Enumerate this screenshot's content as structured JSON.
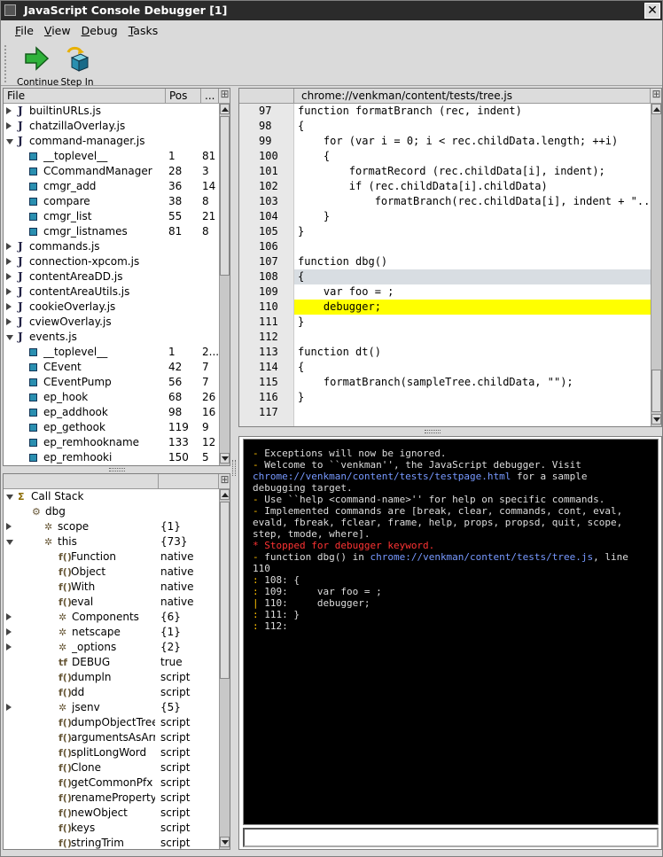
{
  "window": {
    "title": "JavaScript Console Debugger  [1]",
    "close_label": "✕"
  },
  "menu": [
    "File",
    "View",
    "Debug",
    "Tasks"
  ],
  "toolbar": {
    "continue_label": "Continue",
    "stepin_label": "Step In"
  },
  "scripts": {
    "headers": [
      "File",
      "Pos",
      "..."
    ],
    "rows": [
      {
        "kind": "file",
        "open": false,
        "name": "builtinURLs.js",
        "pos": "",
        "len": ""
      },
      {
        "kind": "file",
        "open": false,
        "name": "chatzillaOverlay.js",
        "pos": "",
        "len": ""
      },
      {
        "kind": "file",
        "open": true,
        "name": "command-manager.js",
        "pos": "",
        "len": ""
      },
      {
        "kind": "fn",
        "name": "__toplevel__",
        "pos": "1",
        "len": "81"
      },
      {
        "kind": "fn",
        "name": "CCommandManager",
        "pos": "28",
        "len": "3"
      },
      {
        "kind": "fn",
        "name": "cmgr_add",
        "pos": "36",
        "len": "14"
      },
      {
        "kind": "fn",
        "name": "compare",
        "pos": "38",
        "len": "8"
      },
      {
        "kind": "fn",
        "name": "cmgr_list",
        "pos": "55",
        "len": "21"
      },
      {
        "kind": "fn",
        "name": "cmgr_listnames",
        "pos": "81",
        "len": "8"
      },
      {
        "kind": "file",
        "open": false,
        "name": "commands.js",
        "pos": "",
        "len": ""
      },
      {
        "kind": "file",
        "open": false,
        "name": "connection-xpcom.js",
        "pos": "",
        "len": ""
      },
      {
        "kind": "file",
        "open": false,
        "name": "contentAreaDD.js",
        "pos": "",
        "len": ""
      },
      {
        "kind": "file",
        "open": false,
        "name": "contentAreaUtils.js",
        "pos": "",
        "len": ""
      },
      {
        "kind": "file",
        "open": false,
        "name": "cookieOverlay.js",
        "pos": "",
        "len": ""
      },
      {
        "kind": "file",
        "open": false,
        "name": "cviewOverlay.js",
        "pos": "",
        "len": ""
      },
      {
        "kind": "file",
        "open": true,
        "name": "events.js",
        "pos": "",
        "len": ""
      },
      {
        "kind": "fn",
        "name": "__toplevel__",
        "pos": "1",
        "len": "2..."
      },
      {
        "kind": "fn",
        "name": "CEvent",
        "pos": "42",
        "len": "7"
      },
      {
        "kind": "fn",
        "name": "CEventPump",
        "pos": "56",
        "len": "7"
      },
      {
        "kind": "fn",
        "name": "ep_hook",
        "pos": "68",
        "len": "26"
      },
      {
        "kind": "fn",
        "name": "ep_addhook",
        "pos": "98",
        "len": "16"
      },
      {
        "kind": "fn",
        "name": "ep_gethook",
        "pos": "119",
        "len": "9"
      },
      {
        "kind": "fn",
        "name": "ep_remhookname",
        "pos": "133",
        "len": "12"
      },
      {
        "kind": "fn",
        "name": "ep_remhooki",
        "pos": "150",
        "len": "5"
      }
    ]
  },
  "stack": {
    "rows": [
      {
        "indent": 0,
        "twisty": "open",
        "icon": "sigma",
        "name": "Call Stack",
        "value": ""
      },
      {
        "indent": 1,
        "twisty": "none",
        "icon": "frame",
        "name": "dbg",
        "value": ""
      },
      {
        "indent": 2,
        "twisty": "closed",
        "icon": "obj",
        "name": "scope",
        "value": "{1}"
      },
      {
        "indent": 2,
        "twisty": "open",
        "icon": "obj",
        "name": "this",
        "value": "{73}"
      },
      {
        "indent": 3,
        "twisty": "none",
        "icon": "fn",
        "name": "Function",
        "value": "native"
      },
      {
        "indent": 3,
        "twisty": "none",
        "icon": "fn",
        "name": "Object",
        "value": "native"
      },
      {
        "indent": 3,
        "twisty": "none",
        "icon": "fn",
        "name": "With",
        "value": "native"
      },
      {
        "indent": 3,
        "twisty": "none",
        "icon": "fn",
        "name": "eval",
        "value": "native"
      },
      {
        "indent": 3,
        "twisty": "closed",
        "icon": "obj",
        "name": "Components",
        "value": "{6}"
      },
      {
        "indent": 3,
        "twisty": "closed",
        "icon": "obj",
        "name": "netscape",
        "value": "{1}"
      },
      {
        "indent": 3,
        "twisty": "closed",
        "icon": "obj",
        "name": "_options",
        "value": "{2}"
      },
      {
        "indent": 3,
        "twisty": "none",
        "icon": "bool",
        "name": "DEBUG",
        "value": "true"
      },
      {
        "indent": 3,
        "twisty": "none",
        "icon": "fn",
        "name": "dumpln",
        "value": "script"
      },
      {
        "indent": 3,
        "twisty": "none",
        "icon": "fn",
        "name": "dd",
        "value": "script"
      },
      {
        "indent": 3,
        "twisty": "closed",
        "icon": "obj",
        "name": "jsenv",
        "value": "{5}"
      },
      {
        "indent": 3,
        "twisty": "none",
        "icon": "fn",
        "name": "dumpObjectTree",
        "value": "script"
      },
      {
        "indent": 3,
        "twisty": "none",
        "icon": "fn",
        "name": "argumentsAsArr...",
        "value": "script"
      },
      {
        "indent": 3,
        "twisty": "none",
        "icon": "fn",
        "name": "splitLongWord",
        "value": "script"
      },
      {
        "indent": 3,
        "twisty": "none",
        "icon": "fn",
        "name": "Clone",
        "value": "script"
      },
      {
        "indent": 3,
        "twisty": "none",
        "icon": "fn",
        "name": "getCommonPfx",
        "value": "script"
      },
      {
        "indent": 3,
        "twisty": "none",
        "icon": "fn",
        "name": "renameProperty",
        "value": "script"
      },
      {
        "indent": 3,
        "twisty": "none",
        "icon": "fn",
        "name": "newObject",
        "value": "script"
      },
      {
        "indent": 3,
        "twisty": "none",
        "icon": "fn",
        "name": "keys",
        "value": "script"
      },
      {
        "indent": 3,
        "twisty": "none",
        "icon": "fn",
        "name": "stringTrim",
        "value": "script"
      }
    ]
  },
  "source": {
    "tab_url": "chrome://venkman/content/tests/tree.js",
    "lines": [
      {
        "n": "97",
        "code": "function formatBranch (rec, indent)",
        "hl": ""
      },
      {
        "n": "98",
        "code": "{",
        "hl": ""
      },
      {
        "n": "99",
        "code": "    for (var i = 0; i < rec.childData.length; ++i)",
        "hl": ""
      },
      {
        "n": "100",
        "code": "    {",
        "hl": ""
      },
      {
        "n": "101",
        "code": "        formatRecord (rec.childData[i], indent);",
        "hl": ""
      },
      {
        "n": "102",
        "code": "        if (rec.childData[i].childData)",
        "hl": ""
      },
      {
        "n": "103",
        "code": "            formatBranch(rec.childData[i], indent + \"...",
        "hl": ""
      },
      {
        "n": "104",
        "code": "    }",
        "hl": ""
      },
      {
        "n": "105",
        "code": "}",
        "hl": ""
      },
      {
        "n": "106",
        "code": "",
        "hl": ""
      },
      {
        "n": "107",
        "code": "function dbg()",
        "hl": ""
      },
      {
        "n": "108",
        "code": "{",
        "hl": "gray"
      },
      {
        "n": "109",
        "code": "    var foo = ;",
        "hl": ""
      },
      {
        "n": "110",
        "code": "    debugger;",
        "hl": "yellow"
      },
      {
        "n": "111",
        "code": "}",
        "hl": ""
      },
      {
        "n": "112",
        "code": "",
        "hl": ""
      },
      {
        "n": "113",
        "code": "function dt()",
        "hl": ""
      },
      {
        "n": "114",
        "code": "{",
        "hl": ""
      },
      {
        "n": "115",
        "code": "    formatBranch(sampleTree.childData, \"\");",
        "hl": ""
      },
      {
        "n": "116",
        "code": "}",
        "hl": ""
      },
      {
        "n": "117",
        "code": "",
        "hl": ""
      }
    ]
  },
  "console": {
    "lines": [
      [
        {
          "t": "- ",
          "s": "b"
        },
        {
          "t": "Exceptions will now be ignored.",
          "s": ""
        }
      ],
      [
        {
          "t": "- ",
          "s": "b"
        },
        {
          "t": "Welcome to ``venkman'', the JavaScript debugger. Visit",
          "s": ""
        }
      ],
      [
        {
          "t": "chrome://venkman/content/tests/testpage.html",
          "s": "link"
        },
        {
          "t": " for a sample",
          "s": ""
        }
      ],
      [
        {
          "t": "debugging target.",
          "s": ""
        }
      ],
      [
        {
          "t": "- ",
          "s": "b"
        },
        {
          "t": "Use ``help <command-name>'' for help on specific commands.",
          "s": ""
        }
      ],
      [
        {
          "t": "- ",
          "s": "b"
        },
        {
          "t": "Implemented commands are [break, clear, commands, cont, eval,",
          "s": ""
        }
      ],
      [
        {
          "t": "evald, fbreak, fclear, frame, help, props, propsd, quit, scope,",
          "s": ""
        }
      ],
      [
        {
          "t": "step, tmode, where].",
          "s": ""
        }
      ],
      [
        {
          "t": "* ",
          "s": "red"
        },
        {
          "t": "Stopped for debugger keyword.",
          "s": "red"
        }
      ],
      [
        {
          "t": "- ",
          "s": "b"
        },
        {
          "t": "function dbg() in ",
          "s": ""
        },
        {
          "t": "chrome://venkman/content/tests/tree.js",
          "s": "link"
        },
        {
          "t": ", line",
          "s": ""
        }
      ],
      [
        {
          "t": "110",
          "s": ""
        }
      ],
      [
        {
          "t": ": ",
          "s": "b"
        },
        {
          "t": "108: {",
          "s": ""
        }
      ],
      [
        {
          "t": ": ",
          "s": "b"
        },
        {
          "t": "109:     var foo = ;",
          "s": ""
        }
      ],
      [
        {
          "t": "| ",
          "s": "b"
        },
        {
          "t": "110:     debugger;",
          "s": ""
        }
      ],
      [
        {
          "t": ": ",
          "s": "b"
        },
        {
          "t": "111: }",
          "s": ""
        }
      ],
      [
        {
          "t": ": ",
          "s": "b"
        },
        {
          "t": "112:",
          "s": ""
        }
      ]
    ]
  },
  "colors": {
    "highlight_line": "#ffff00",
    "current_line": "#d8dde2",
    "console_bg": "#000000",
    "link": "#7799ff",
    "error": "#ff3333",
    "bullet": "#ffc000"
  }
}
